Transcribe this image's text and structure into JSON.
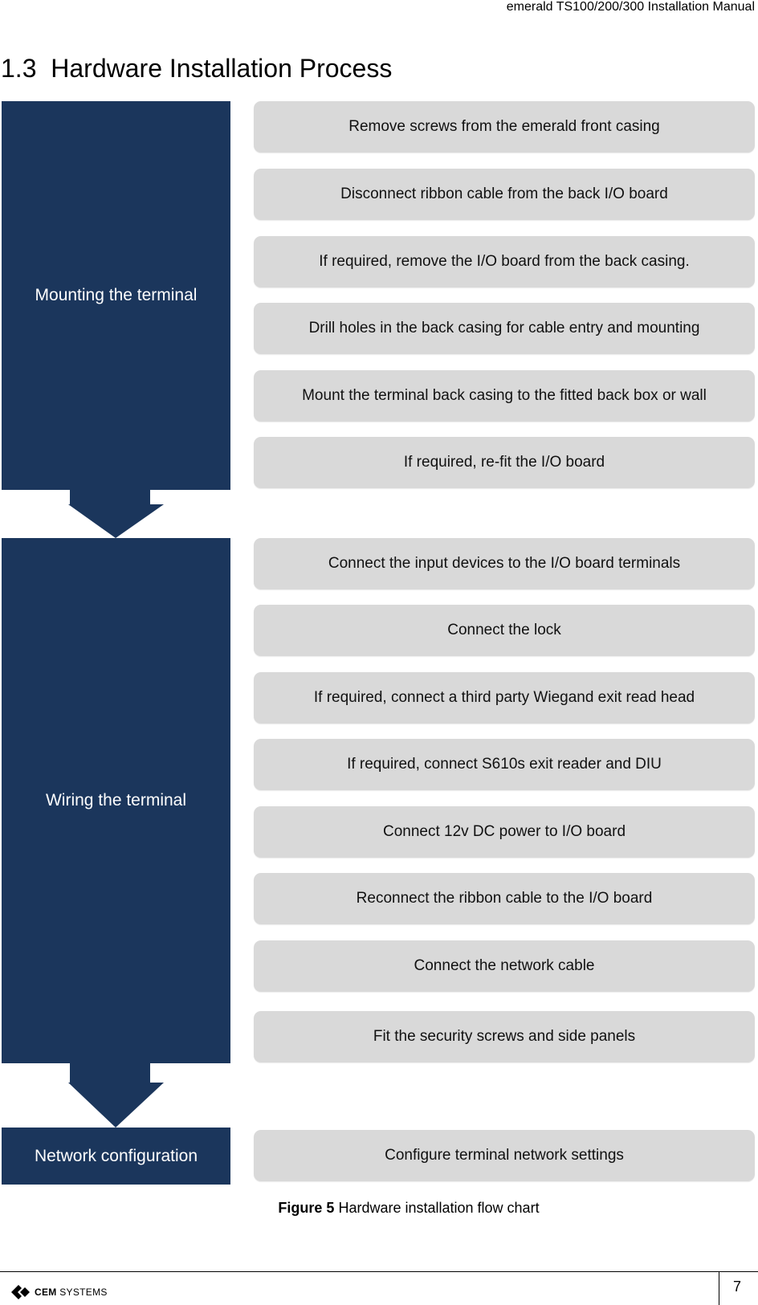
{
  "header": {
    "title": "emerald TS100/200/300 Installation Manual"
  },
  "section": {
    "number": "1.3",
    "title": "Hardware Installation Process"
  },
  "colors": {
    "stage_fill": "#1b365c",
    "step_fill": "#d9d9d9"
  },
  "flowchart": {
    "stages": [
      {
        "label": "Mounting the terminal",
        "steps": [
          "Remove screws from the emerald front casing",
          "Disconnect ribbon cable from the back I/O board",
          "If required, remove the I/O board from the back casing.",
          "Drill holes in the back casing for cable entry and mounting",
          "Mount the terminal back casing to the fitted back box or wall",
          "If required, re-fit the I/O board"
        ]
      },
      {
        "label": "Wiring the terminal",
        "steps": [
          "Connect the input devices to the I/O board terminals",
          "Connect the lock",
          "If required, connect a third party Wiegand exit read head",
          "If required, connect S610s exit reader and DIU",
          "Connect 12v DC power to I/O board",
          "Reconnect the ribbon cable to the I/O board",
          "Connect the network cable",
          "Fit the security screws and side panels"
        ]
      },
      {
        "label": "Network configuration",
        "steps": [
          "Configure terminal network settings"
        ]
      }
    ]
  },
  "caption": {
    "label": "Figure 5",
    "text": "Hardware installation flow chart"
  },
  "footer": {
    "logo_bold": "CEM",
    "logo_rest": "SYSTEMS",
    "page_number": "7"
  }
}
